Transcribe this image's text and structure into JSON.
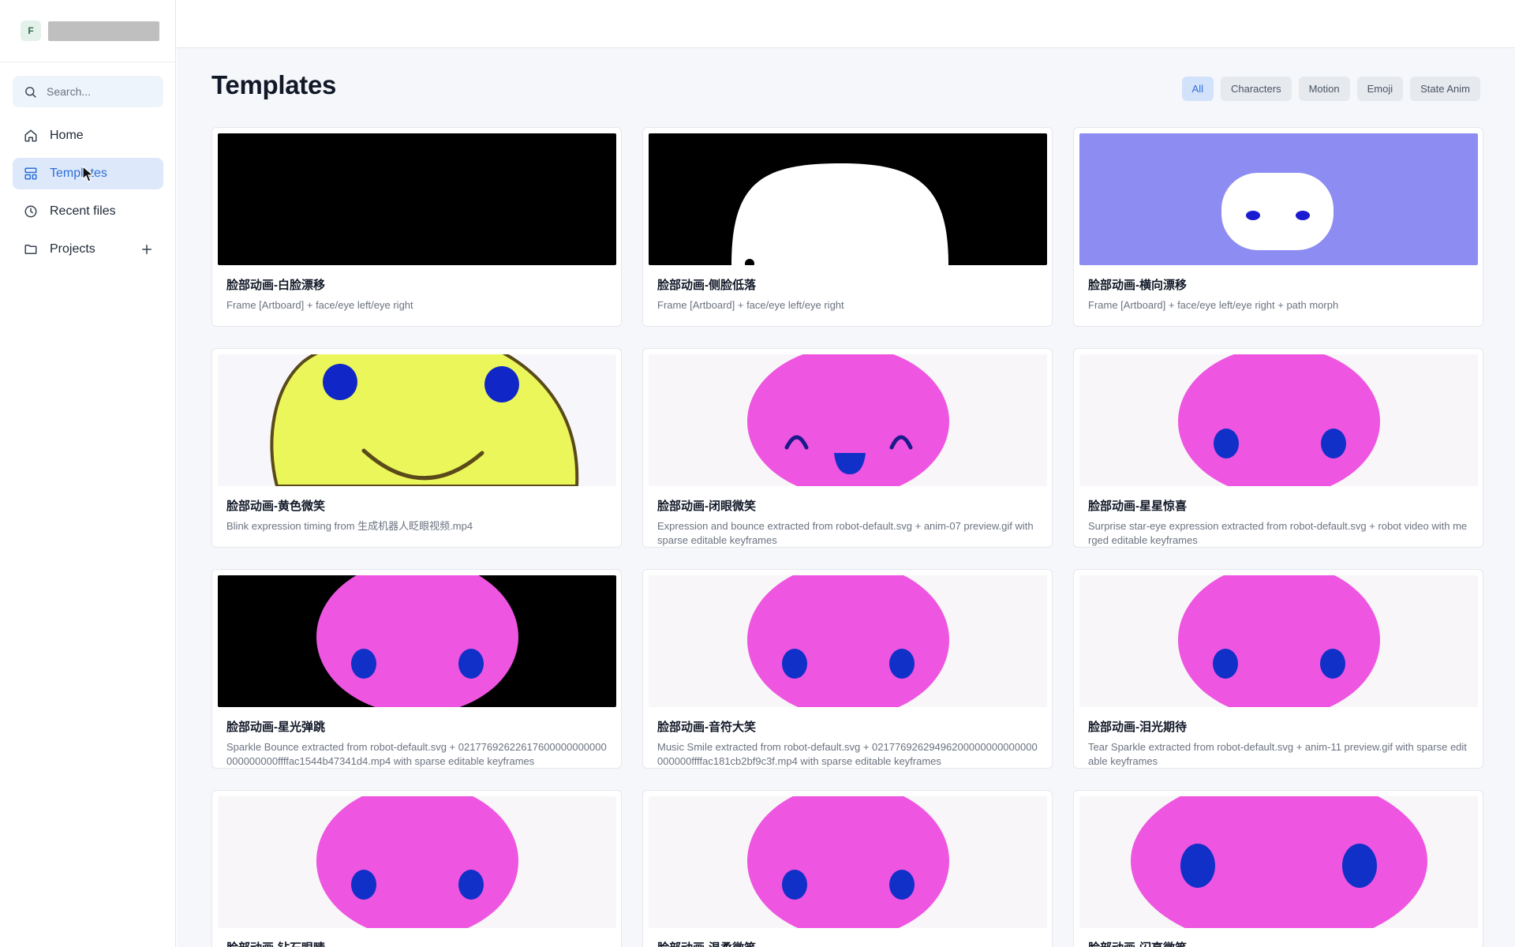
{
  "sidebar": {
    "logo_letter": "F",
    "search_placeholder": "Search...",
    "nav": [
      {
        "label": "Home"
      },
      {
        "label": "Templates"
      },
      {
        "label": "Recent files"
      },
      {
        "label": "Projects"
      }
    ],
    "active_index": 1
  },
  "main": {
    "title": "Templates",
    "filters": [
      "All",
      "Characters",
      "Motion",
      "Emoji",
      "State Anim"
    ],
    "active_filter": "All",
    "templates": [
      {
        "title": "脸部动画-白脸漂移",
        "desc": "Frame [Artboard] + face/eye left/eye right",
        "thumb": "white-face-drift"
      },
      {
        "title": "脸部动画-侧脸低落",
        "desc": "Frame [Artboard] + face/eye left/eye right",
        "thumb": "side-face-low"
      },
      {
        "title": "脸部动画-横向漂移",
        "desc": "Frame [Artboard] + face/eye left/eye right + path morph",
        "thumb": "horizontal-drift"
      },
      {
        "title": "脸部动画-黄色微笑",
        "desc": "Blink expression timing from 生成机器人眨眼视频.mp4",
        "thumb": "yellow-smile"
      },
      {
        "title": "脸部动画-闭眼微笑",
        "desc": "Expression and bounce extracted from robot-default.svg + anim-07 preview.gif with sparse editable keyframes",
        "thumb": "closed-eye-smile"
      },
      {
        "title": "脸部动画-星星惊喜",
        "desc": "Surprise star-eye expression extracted from robot-default.svg + robot video with merged editable keyframes",
        "thumb": "pink-face"
      },
      {
        "title": "脸部动画-星光弹跳",
        "desc": "Sparkle Bounce extracted from robot-default.svg + 02177692622617600000000000000000000ffffac1544b47341d4.mp4 with sparse editable keyframes",
        "thumb": "pink-face-dark"
      },
      {
        "title": "脸部动画-音符大笑",
        "desc": "Music Smile extracted from robot-default.svg + 02177692629496200000000000000000000ffffac181cb2bf9c3f.mp4 with sparse editable keyframes",
        "thumb": "pink-face"
      },
      {
        "title": "脸部动画-泪光期待",
        "desc": "Tear Sparkle extracted from robot-default.svg + anim-11 preview.gif with sparse editable keyframes",
        "thumb": "pink-face"
      },
      {
        "title": "脸部动画-钻石眼睛",
        "desc": "",
        "thumb": "pink-face"
      },
      {
        "title": "脸部动画-温柔微笑",
        "desc": "",
        "thumb": "pink-face"
      },
      {
        "title": "脸部动画-闪亮微笑",
        "desc": "",
        "thumb": "pink-face-wide"
      }
    ]
  },
  "colors": {
    "accent": "#2f6ed6",
    "active_bg": "#dde9fb",
    "face_pink": "#ee55e0",
    "eye_blue": "#1030c8",
    "face_yellow": "#eaf65a",
    "lavender_bg": "#8c8cf2"
  }
}
